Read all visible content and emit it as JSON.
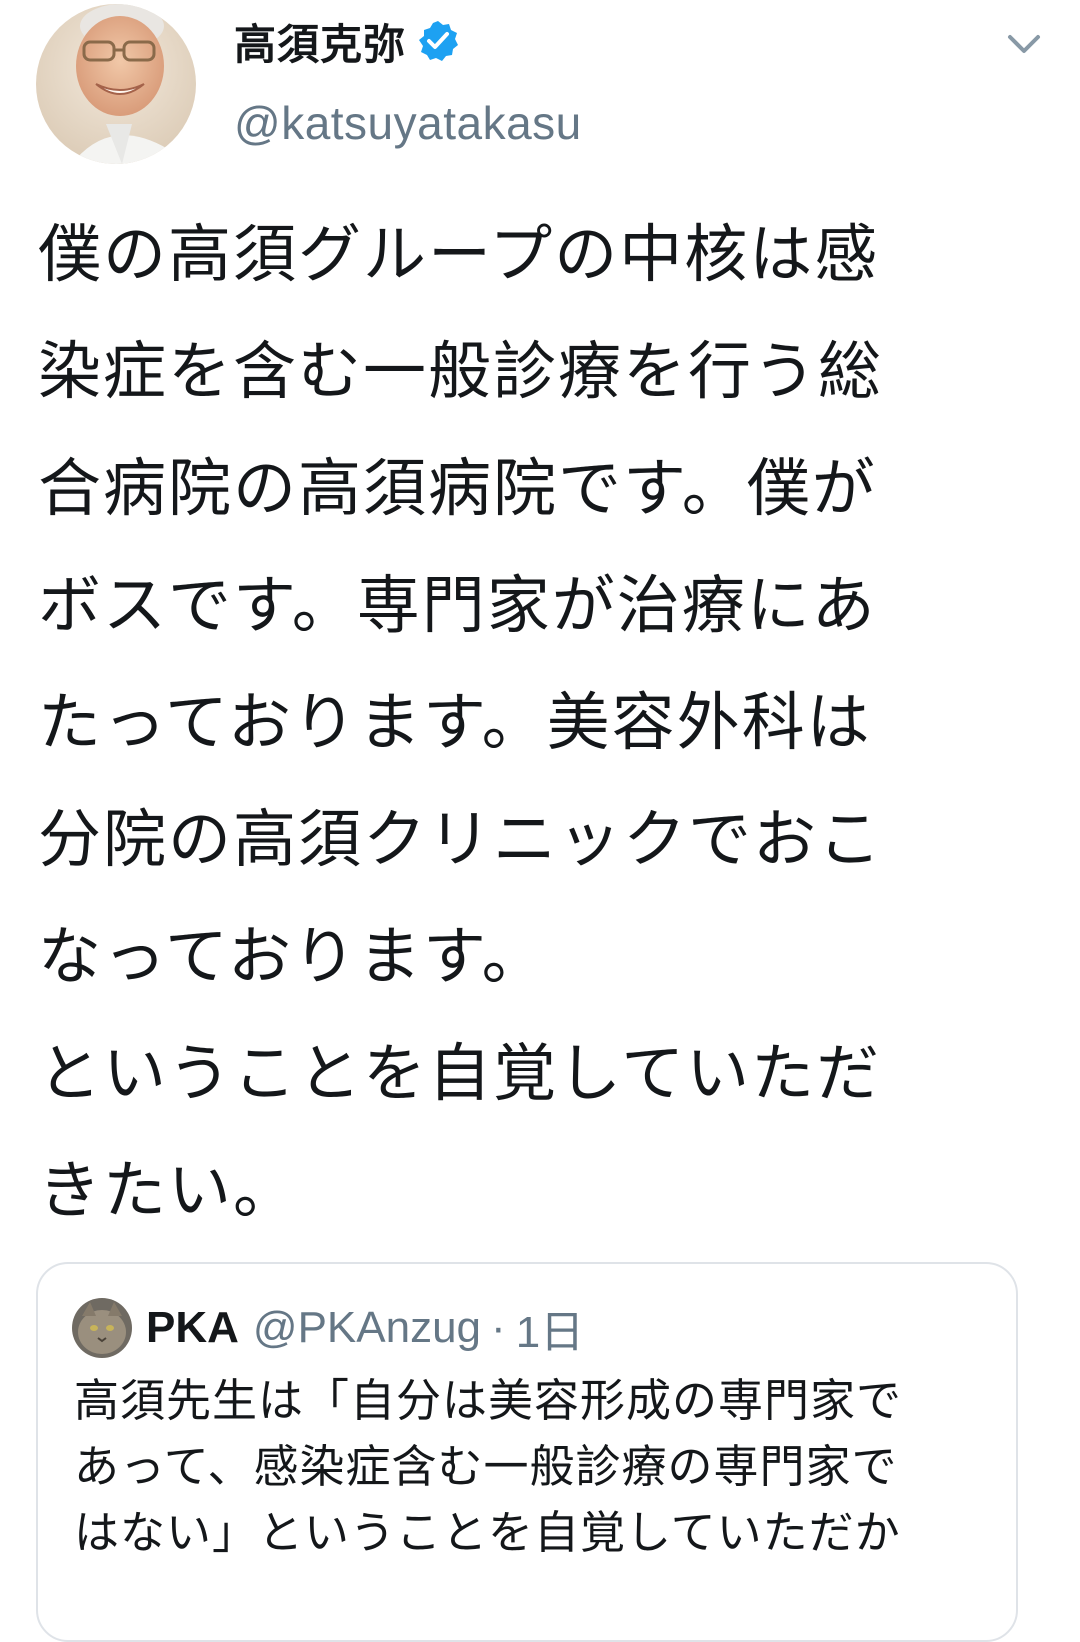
{
  "tweet": {
    "display_name": "高須克弥",
    "handle": "@katsuyatakasu",
    "verified": true,
    "verified_icon": "verified-badge-icon",
    "menu_icon": "chevron-down-icon",
    "text": "僕の高須グループの中核は感\n染症を含む一般診療を行う総\n合病院の高須病院です。僕が\nボスです。専門家が治療にあ\nたっております。美容外科は\n分院の高須クリニックでおこ\nなっております。\nということを自覚していただ\nきたい。"
  },
  "quoted_tweet": {
    "display_name": "PKA",
    "handle": "@PKAnzug",
    "separator": "·",
    "time": "1日",
    "text": "高須先生は「自分は美容形成の専門家で\nあって、感染症含む一般診療の専門家で\nはない」ということを自覚していただか"
  },
  "colors": {
    "primary_text": "#14171a",
    "secondary_text": "#657786",
    "verified_blue": "#1da1f2",
    "border": "#dfe3e8"
  }
}
